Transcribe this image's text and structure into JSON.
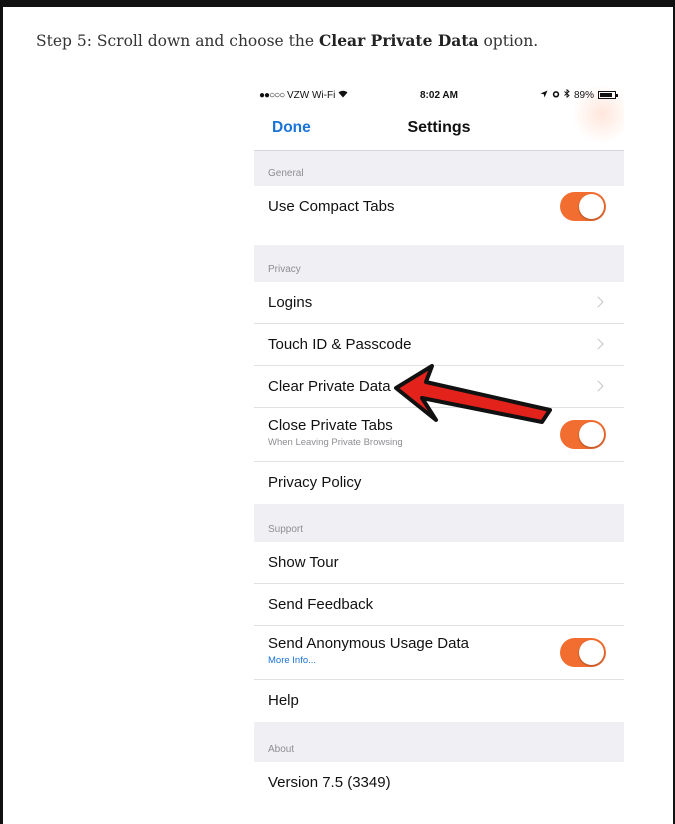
{
  "instruction": {
    "prefix": "Step 5: Scroll down and choose the ",
    "bold": "Clear Private Data",
    "suffix": " option."
  },
  "status_bar": {
    "signal_dots": "●●○○○",
    "carrier": "VZW Wi-Fi",
    "wifi_icon": "wifi-icon",
    "time": "8:02 AM",
    "location_icon": "location-arrow-icon",
    "alarm_icon": "alarm-icon",
    "bluetooth_icon": "bluetooth-icon",
    "battery_percent": "89%",
    "battery_level": 0.89
  },
  "nav": {
    "done_label": "Done",
    "title": "Settings"
  },
  "sections": {
    "general": "General",
    "privacy": "Privacy",
    "support": "Support",
    "about": "About"
  },
  "rows": {
    "use_compact_tabs": {
      "label": "Use Compact Tabs",
      "on": true
    },
    "logins": {
      "label": "Logins"
    },
    "touch_id": {
      "label": "Touch ID & Passcode"
    },
    "clear_private_data": {
      "label": "Clear Private Data"
    },
    "close_private_tabs": {
      "label": "Close Private Tabs",
      "sub": "When Leaving Private Browsing",
      "on": true
    },
    "privacy_policy": {
      "label": "Privacy Policy"
    },
    "show_tour": {
      "label": "Show Tour"
    },
    "send_feedback": {
      "label": "Send Feedback"
    },
    "send_anonymous_usage": {
      "label": "Send Anonymous Usage Data",
      "sub": "More Info...",
      "on": true
    },
    "help": {
      "label": "Help"
    },
    "version": {
      "label": "Version 7.5 (3349)"
    }
  },
  "colors": {
    "toggle_on": "#f26e30",
    "link_blue": "#1a73d9",
    "arrow_red": "#e3221c",
    "section_bg": "#efeff4"
  },
  "annotation": {
    "icon": "red-arrow-icon"
  }
}
